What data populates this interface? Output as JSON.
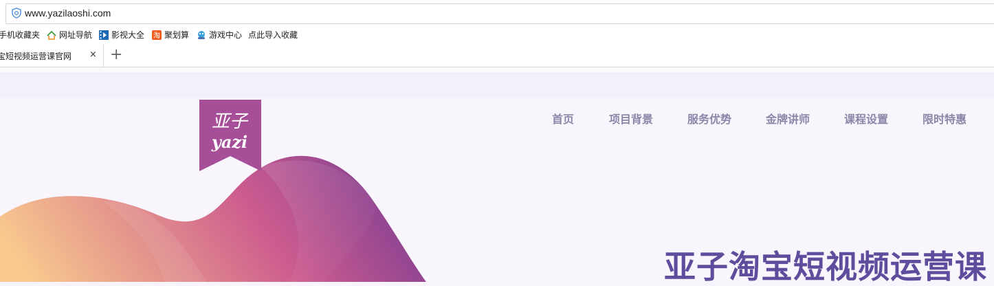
{
  "browser": {
    "url": "www.yazilaoshi.com",
    "favorites": [
      {
        "label": "手机收藏夹",
        "icon": "phone-icon"
      },
      {
        "label": "网址导航",
        "icon": "nav-house-icon"
      },
      {
        "label": "影视大全",
        "icon": "film-icon"
      },
      {
        "label": "聚划算",
        "icon": "juhuasuan-icon"
      },
      {
        "label": "游戏中心",
        "icon": "game-icon"
      },
      {
        "label": "点此导入收藏",
        "icon": ""
      }
    ],
    "tab": {
      "title": "宝短视频运营课官网",
      "close": "×"
    },
    "new_tab": "+"
  },
  "page": {
    "logo": {
      "line1": "亚子",
      "line2": "yazi"
    },
    "nav": [
      "首页",
      "项目背景",
      "服务优势",
      "金牌讲师",
      "课程设置",
      "限时特惠"
    ],
    "hero_title": "亚子淘宝短视频运营课",
    "colors": {
      "nav_text": "#8b86a8",
      "hero_title": "#5d4d9c",
      "logo_bg": "#a64e97",
      "wave_start": "#f8c88e",
      "wave_mid": "#cd5c8f",
      "wave_end": "#7d3d92"
    }
  }
}
